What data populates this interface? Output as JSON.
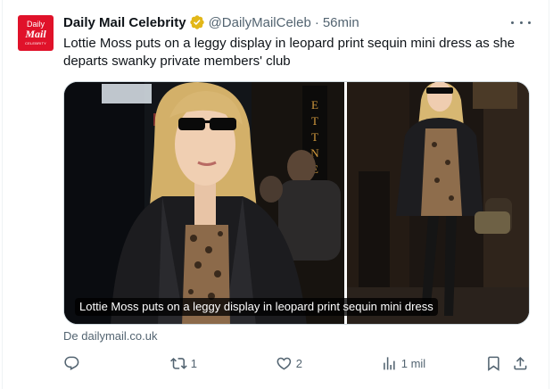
{
  "tweet": {
    "avatar": {
      "line1": "Daily",
      "line2": "Mail",
      "line3": "CELEBRITY"
    },
    "author_name": "Daily Mail Celebrity",
    "handle": "@DailyMailCeleb",
    "separator": "·",
    "time": "56min",
    "text": "Lottie Moss puts on a leggy display in leopard print sequin mini dress as she departs swanky private members' club",
    "card": {
      "caption": "Lottie Moss puts on a leggy display in leopard print sequin mini dress",
      "sign_letters": "ETTNERS"
    },
    "source": "De dailymail.co.uk",
    "actions": {
      "reply_count": "",
      "retweet_count": "1",
      "like_count": "2",
      "views_count": "1 mil"
    }
  },
  "colors": {
    "text_primary": "#0f1419",
    "text_secondary": "#536471",
    "verified_gold": "#e2b719",
    "brand_red": "#e0122a",
    "border": "#cfd9de"
  },
  "icons": [
    "verified-badge-icon",
    "more-icon",
    "reply-icon",
    "retweet-icon",
    "like-icon",
    "views-icon",
    "bookmark-icon",
    "share-icon"
  ]
}
